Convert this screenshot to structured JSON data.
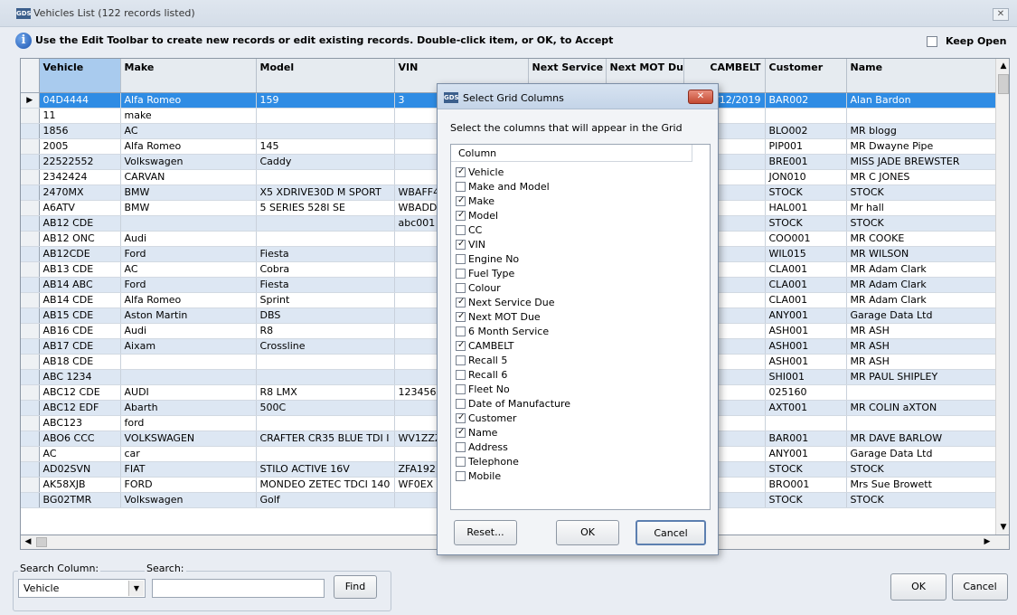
{
  "window": {
    "app_icon_text": "GDS",
    "title": "Vehicles List  (122 records listed)",
    "close_glyph": "✕"
  },
  "info": {
    "icon_glyph": "i",
    "text": "Use the Edit Toolbar to create new records or edit existing records. Double-click item, or OK, to Accept",
    "keep_open_label": "Keep Open",
    "keep_open_checked": false
  },
  "grid": {
    "selected_marker": "▶",
    "columns": [
      "Vehicle",
      "Make",
      "Model",
      "VIN",
      "Next Service Due",
      "Next MOT Due",
      "CAMBELT",
      "Customer",
      "Name"
    ],
    "rows": [
      [
        "04D4444",
        "Alfa Romeo",
        "159",
        "3",
        "",
        "",
        "6/12/2019",
        "BAR002",
        "Alan Bardon"
      ],
      [
        "11",
        "make",
        "",
        "",
        "",
        "",
        "",
        "",
        ""
      ],
      [
        "1856",
        "AC",
        "",
        "",
        "",
        "",
        "",
        "BLO002",
        "MR blogg"
      ],
      [
        "2005",
        "Alfa Romeo",
        "145",
        "",
        "",
        "",
        "",
        "PIP001",
        "MR Dwayne Pipe"
      ],
      [
        "22522552",
        "Volkswagen",
        "Caddy",
        "",
        "",
        "",
        "",
        "BRE001",
        "MISS JADE BREWSTER"
      ],
      [
        "2342424",
        "CARVAN",
        "",
        "",
        "",
        "",
        "",
        "JON010",
        "MR C JONES"
      ],
      [
        "2470MX",
        "BMW",
        "X5 XDRIVE30D M SPORT",
        "WBAFF4",
        "",
        "",
        "",
        "STOCK",
        "STOCK"
      ],
      [
        "A6ATV",
        "BMW",
        "5 SERIES 528I SE",
        "WBADD",
        "",
        "",
        "",
        "HAL001",
        "Mr  hall"
      ],
      [
        "AB12 CDE",
        "",
        "",
        "abc001",
        "",
        "",
        "",
        "STOCK",
        "STOCK"
      ],
      [
        "AB12 ONC",
        "Audi",
        "",
        "",
        "",
        "",
        "",
        "COO001",
        "MR  COOKE"
      ],
      [
        "AB12CDE",
        "Ford",
        "Fiesta",
        "",
        "",
        "",
        "",
        "WIL015",
        "MR  WILSON"
      ],
      [
        "AB13 CDE",
        "AC",
        "Cobra",
        "",
        "",
        "",
        "",
        "CLA001",
        "MR Adam Clark"
      ],
      [
        "AB14 ABC",
        "Ford",
        "Fiesta",
        "",
        "",
        "",
        "",
        "CLA001",
        "MR Adam Clark"
      ],
      [
        "AB14 CDE",
        "Alfa Romeo",
        "Sprint",
        "",
        "",
        "",
        "",
        "CLA001",
        "MR Adam Clark"
      ],
      [
        "AB15 CDE",
        "Aston Martin",
        "DBS",
        "",
        "",
        "",
        "",
        "ANY001",
        "Garage Data Ltd"
      ],
      [
        "AB16 CDE",
        "Audi",
        "R8",
        "",
        "",
        "",
        "",
        "ASH001",
        "MR ASH"
      ],
      [
        "AB17 CDE",
        "Aixam",
        "Crossline",
        "",
        "",
        "",
        "",
        "ASH001",
        "MR ASH"
      ],
      [
        "AB18 CDE",
        "",
        "",
        "",
        "",
        "",
        "",
        "ASH001",
        "MR ASH"
      ],
      [
        "ABC 1234",
        "",
        "",
        "",
        "",
        "",
        "",
        "SHI001",
        "MR PAUL SHIPLEY"
      ],
      [
        "ABC12 CDE",
        "AUDI",
        "R8 LMX",
        "1234567",
        "",
        "",
        "",
        "025160",
        ""
      ],
      [
        "ABC12 EDF",
        "Abarth",
        "500C",
        "",
        "",
        "",
        "",
        "AXT001",
        "MR COLIN aXTON"
      ],
      [
        "ABC123",
        "ford",
        "",
        "",
        "",
        "",
        "",
        "",
        ""
      ],
      [
        "ABO6 CCC",
        "VOLKSWAGEN",
        "CRAFTER CR35 BLUE TDI I",
        "WV1ZZZ",
        "",
        "",
        "",
        "BAR001",
        "MR DAVE BARLOW"
      ],
      [
        "AC",
        "car",
        "",
        "",
        "",
        "",
        "",
        "ANY001",
        "Garage Data Ltd"
      ],
      [
        "AD02SVN",
        "FIAT",
        "STILO ACTIVE 16V",
        "ZFA192",
        "",
        "",
        "",
        "STOCK",
        "STOCK"
      ],
      [
        "AK58XJB",
        "FORD",
        "MONDEO ZETEC TDCI 140",
        "WF0EX",
        "",
        "",
        "",
        "BRO001",
        "Mrs Sue Browett"
      ],
      [
        "BG02TMR",
        "Volkswagen",
        "Golf",
        "",
        "",
        "",
        "",
        "STOCK",
        "STOCK"
      ]
    ]
  },
  "search": {
    "column_label": "Search Column:",
    "column_value": "Vehicle",
    "search_label": "Search:",
    "search_value": "",
    "find_label": "Find"
  },
  "footer": {
    "ok_label": "OK",
    "cancel_label": "Cancel"
  },
  "dialog": {
    "icon_text": "GDS",
    "title": "Select Grid Columns",
    "close_glyph": "✕",
    "instruction": "Select the columns that will appear in the Grid",
    "list_header": "Column",
    "items": [
      {
        "label": "Vehicle",
        "checked": true
      },
      {
        "label": "Make and Model",
        "checked": false
      },
      {
        "label": "Make",
        "checked": true
      },
      {
        "label": "Model",
        "checked": true
      },
      {
        "label": "CC",
        "checked": false
      },
      {
        "label": "VIN",
        "checked": true
      },
      {
        "label": "Engine No",
        "checked": false
      },
      {
        "label": "Fuel Type",
        "checked": false
      },
      {
        "label": "Colour",
        "checked": false
      },
      {
        "label": "Next Service Due",
        "checked": true
      },
      {
        "label": "Next MOT Due",
        "checked": true
      },
      {
        "label": "6 Month Service",
        "checked": false
      },
      {
        "label": "CAMBELT",
        "checked": true
      },
      {
        "label": "Recall 5",
        "checked": false
      },
      {
        "label": "Recall 6",
        "checked": false
      },
      {
        "label": "Fleet No",
        "checked": false
      },
      {
        "label": "Date of Manufacture",
        "checked": false
      },
      {
        "label": "Customer",
        "checked": true
      },
      {
        "label": "Name",
        "checked": true
      },
      {
        "label": "Address",
        "checked": false
      },
      {
        "label": "Telephone",
        "checked": false
      },
      {
        "label": "Mobile",
        "checked": false
      }
    ],
    "reset_label": "Reset...",
    "ok_label": "OK",
    "cancel_label": "Cancel"
  }
}
